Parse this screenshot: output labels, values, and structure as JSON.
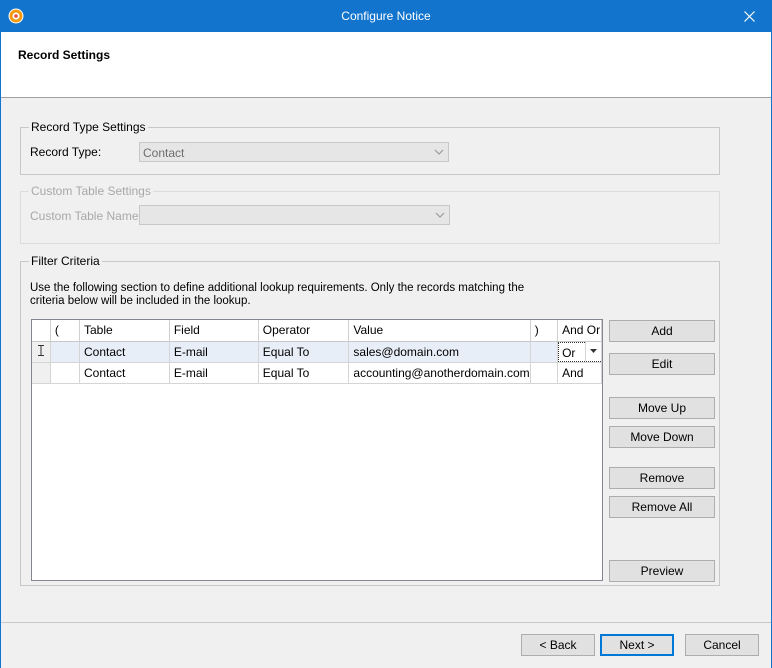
{
  "window": {
    "title": "Configure Notice"
  },
  "header": {
    "title": "Record Settings"
  },
  "record_type": {
    "group_label": "Record Type Settings",
    "field_label": "Record Type:",
    "value": "Contact"
  },
  "custom_table": {
    "group_label": "Custom Table Settings",
    "field_label": "Custom Table Name:",
    "value": ""
  },
  "filter": {
    "group_label": "Filter Criteria",
    "description": "Use the following section to define additional lookup requirements. Only the records matching the criteria below will be included in the lookup.",
    "columns": [
      "(",
      "Table",
      "Field",
      "Operator",
      "Value",
      ")",
      "And Or"
    ],
    "rows": [
      {
        "open": "",
        "table": "Contact",
        "field": "E-mail",
        "operator": "Equal To",
        "value": "sales@domain.com",
        "close": "",
        "andor": "Or"
      },
      {
        "open": "",
        "table": "Contact",
        "field": "E-mail",
        "operator": "Equal To",
        "value": "accounting@anotherdomain.com",
        "close": "",
        "andor": "And"
      }
    ],
    "buttons": {
      "add": "Add",
      "edit": "Edit",
      "move_up": "Move Up",
      "move_down": "Move Down",
      "remove": "Remove",
      "remove_all": "Remove All",
      "preview": "Preview"
    }
  },
  "footer": {
    "back": "< Back",
    "next": "Next >",
    "cancel": "Cancel"
  },
  "colors": {
    "titlebar": "#1274cc",
    "selected_row": "#e8eef8",
    "default_button_border": "#0078d7"
  }
}
